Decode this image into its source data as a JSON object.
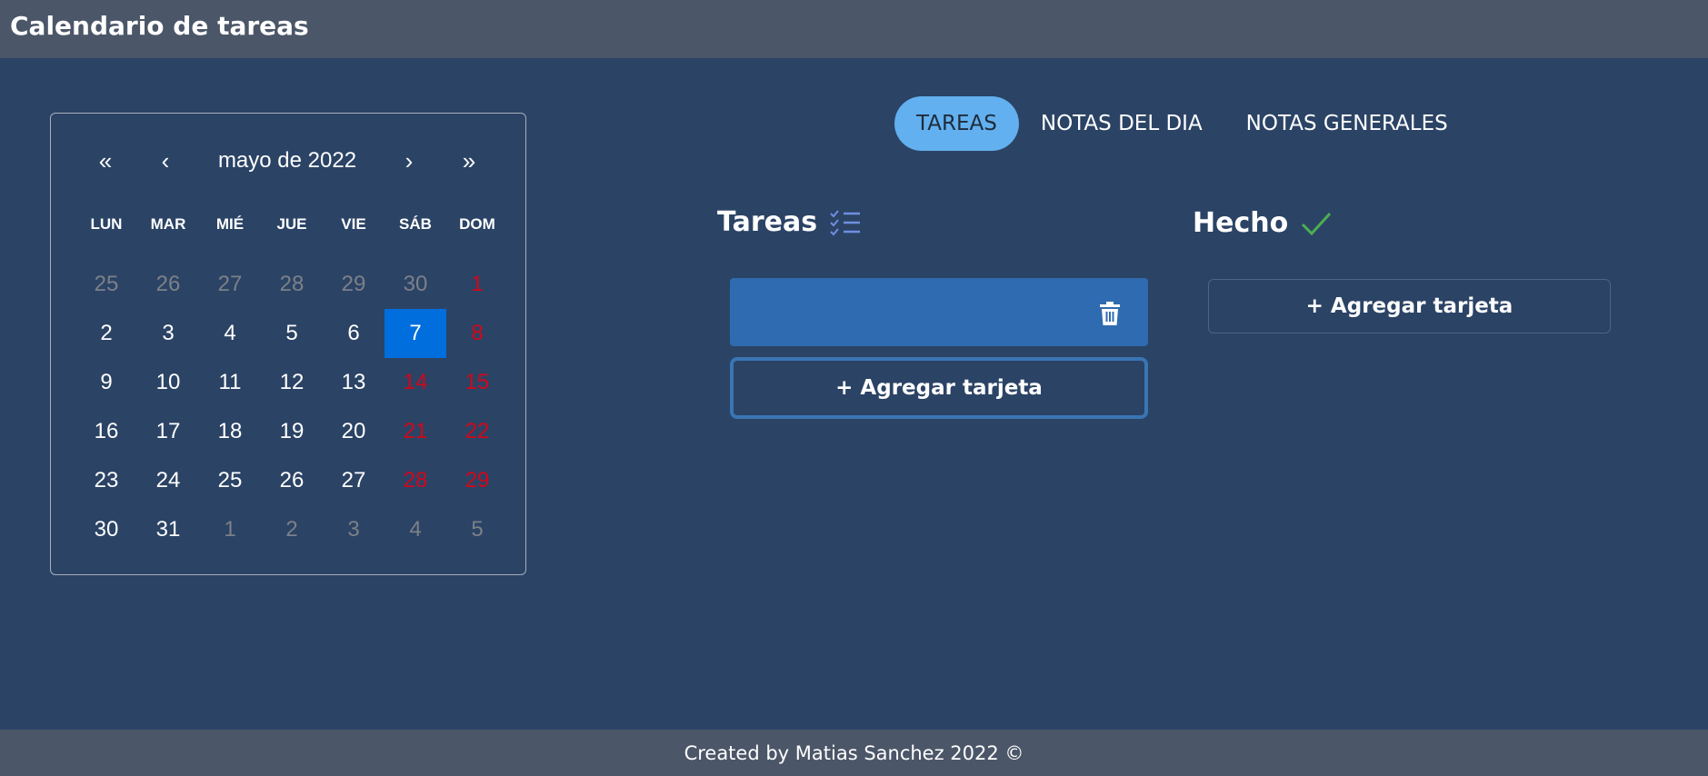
{
  "app": {
    "title": "Calendario de tareas"
  },
  "calendar": {
    "nav": {
      "prev_year": "«",
      "prev_month": "‹",
      "next_month": "›",
      "next_year": "»"
    },
    "month_label": "mayo de 2022",
    "weekdays": [
      "LUN",
      "MAR",
      "MIÉ",
      "JUE",
      "VIE",
      "SÁB",
      "DOM"
    ],
    "selected_day": "7",
    "weeks": [
      [
        "25",
        "26",
        "27",
        "28",
        "29",
        "30",
        "1"
      ],
      [
        "2",
        "3",
        "4",
        "5",
        "6",
        "7",
        "8"
      ],
      [
        "9",
        "10",
        "11",
        "12",
        "13",
        "14",
        "15"
      ],
      [
        "16",
        "17",
        "18",
        "19",
        "20",
        "21",
        "22"
      ],
      [
        "23",
        "24",
        "25",
        "26",
        "27",
        "28",
        "29"
      ],
      [
        "30",
        "31",
        "1",
        "2",
        "3",
        "4",
        "5"
      ]
    ],
    "weekend_color": "#d0081a",
    "outside_color": "#7c8088",
    "selected_color": "#006edc"
  },
  "tabs": [
    {
      "label": "TAREAS",
      "active": true
    },
    {
      "label": "NOTAS DEL DIA",
      "active": false
    },
    {
      "label": "NOTAS GENERALES",
      "active": false
    }
  ],
  "columns": {
    "todo": {
      "title": "Tareas",
      "icon": "checklist-icon",
      "cards": [
        {
          "text": "",
          "icon": "trash-icon"
        }
      ],
      "add_label": "+ Agregar tarjeta"
    },
    "done": {
      "title": "Hecho",
      "icon": "checkmark-icon",
      "add_label": "+ Agregar tarjeta"
    }
  },
  "footer": {
    "text": "Created by Matias Sanchez 2022 ©"
  },
  "colors": {
    "background": "#2b4365",
    "header": "#4b5668",
    "tab_active": "#62b0ef",
    "card": "#2f6bb0",
    "checkmark": "#4caf50"
  }
}
